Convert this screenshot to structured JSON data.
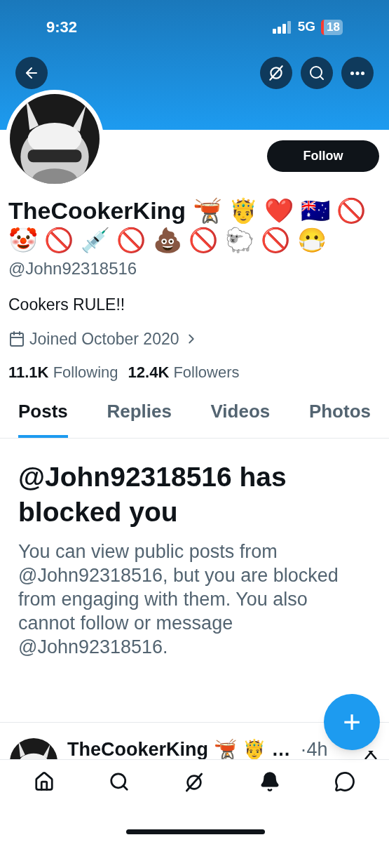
{
  "status_bar": {
    "time": "9:32",
    "network": "5G",
    "battery": "18"
  },
  "profile": {
    "name": "TheCookerKing 🫕 🤴 ❤️ 🇦🇺 🚫 🤡 🚫 💉 🚫 💩 🚫 🐑 🚫 😷",
    "handle": "@John92318516",
    "bio": "Cookers RULE!!",
    "joined": "Joined October 2020",
    "following_count": "11.1K",
    "following_label": "Following",
    "followers_count": "12.4K",
    "followers_label": "Followers",
    "follow_button": "Follow"
  },
  "tabs": [
    {
      "label": "Posts",
      "selected": true
    },
    {
      "label": "Replies",
      "selected": false
    },
    {
      "label": "Videos",
      "selected": false
    },
    {
      "label": "Photos",
      "selected": false
    }
  ],
  "blocked_notice": {
    "title": "@John92318516 has blocked you",
    "message": "You can view public posts from @John92318516, but you are blocked from engaging with them. You also cannot follow or message @John92318516."
  },
  "post_preview": {
    "name": "TheCookerKing 🫕 🤴 …",
    "time": "·4h"
  },
  "fab": {
    "label": "+"
  }
}
